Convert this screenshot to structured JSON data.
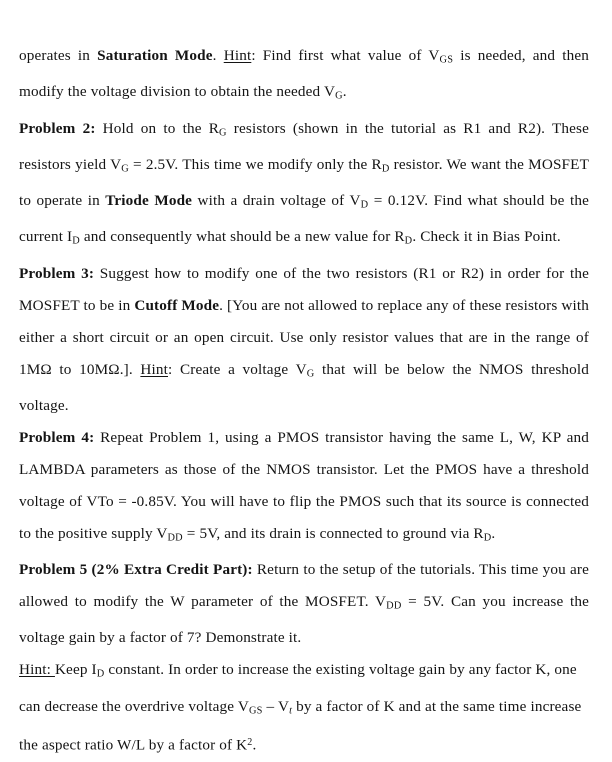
{
  "document": {
    "type": "homework-problem-set",
    "subject": "MOSFET bias and amplifier problems",
    "text_color": "#141414",
    "background_color": "#ffffff"
  },
  "paragraphs": [
    {
      "id": "problem1-tail",
      "heading": "",
      "runs": [
        {
          "text": "operates in ",
          "style": "normal"
        },
        {
          "text": "Saturation Mode",
          "style": "bold"
        },
        {
          "text": ". ",
          "style": "normal"
        },
        {
          "text": "Hint",
          "style": "underline"
        },
        {
          "text": ": Find first what value of V",
          "style": "normal"
        },
        {
          "text": "GS",
          "style": "subscript"
        },
        {
          "text": " is needed, and then modify the voltage division to obtain the needed V",
          "style": "normal"
        },
        {
          "text": "G",
          "style": "subscript"
        },
        {
          "text": ".",
          "style": "normal"
        }
      ],
      "plain": "operates in Saturation Mode. Hint: Find first what value of VGS is needed, and then modify the voltage division to obtain the needed VG."
    },
    {
      "id": "problem2",
      "heading": "Problem 2:",
      "runs": [
        {
          "text": "Problem 2:",
          "style": "bold"
        },
        {
          "text": " Hold on to the R",
          "style": "normal"
        },
        {
          "text": "G",
          "style": "subscript"
        },
        {
          "text": " resistors (shown in the tutorial as R1 and R2). These resistors yield V",
          "style": "normal"
        },
        {
          "text": "G",
          "style": "subscript"
        },
        {
          "text": " = 2.5V. This time we modify only the R",
          "style": "normal"
        },
        {
          "text": "D",
          "style": "subscript"
        },
        {
          "text": " resistor. We want the MOSFET to operate in ",
          "style": "normal"
        },
        {
          "text": "Triode Mode",
          "style": "bold"
        },
        {
          "text": " with a drain voltage of V",
          "style": "normal"
        },
        {
          "text": "D",
          "style": "subscript"
        },
        {
          "text": " = 0.12V. Find what should be the current I",
          "style": "normal"
        },
        {
          "text": "D",
          "style": "subscript"
        },
        {
          "text": " and consequently what should be a new value for R",
          "style": "normal"
        },
        {
          "text": "D",
          "style": "subscript"
        },
        {
          "text": ". Check it in Bias Point.",
          "style": "normal"
        }
      ],
      "plain": "Problem 2: Hold on to the RG resistors (shown in the tutorial as R1 and R2). These resistors yield VG = 2.5V. This time we modify only the RD resistor. We want the MOSFET to operate in Triode Mode with a drain voltage of VD = 0.12V. Find what should be the current ID and consequently what should be a new value for RD. Check it in Bias Point."
    },
    {
      "id": "problem3",
      "heading": "Problem 3:",
      "runs": [
        {
          "text": "Problem 3:",
          "style": "bold"
        },
        {
          "text": " Suggest how to modify one of the two resistors (R1 or R2) in order for the MOSFET to be in ",
          "style": "normal"
        },
        {
          "text": "Cutoff Mode",
          "style": "bold"
        },
        {
          "text": ". [You are not allowed to replace any of these resistors with either a short circuit or an open circuit. Use only resistor values that are in the range of 1MΩ to 10MΩ.]. ",
          "style": "normal"
        },
        {
          "text": "Hint",
          "style": "underline"
        },
        {
          "text": ": Create a voltage V",
          "style": "normal"
        },
        {
          "text": "G",
          "style": "subscript"
        },
        {
          "text": " that will be below the NMOS threshold voltage.",
          "style": "normal"
        }
      ],
      "plain": "Problem 3: Suggest how to modify one of the two resistors (R1 or R2) in order for the MOSFET to be in Cutoff Mode. [You are not allowed to replace any of these resistors with either a short circuit or an open circuit. Use only resistor values that are in the range of 1MΩ to 10MΩ.]. Hint: Create a voltage VG that will be below the NMOS threshold voltage."
    },
    {
      "id": "problem4",
      "heading": "Problem 4:",
      "runs": [
        {
          "text": "Problem 4:",
          "style": "bold"
        },
        {
          "text": " Repeat Problem 1, using a PMOS transistor having the same L, W, KP and LAMBDA parameters as those of the NMOS transistor. Let the PMOS have a threshold voltage of VTo = -0.85V. You will have to flip the PMOS such that its source is connected to the positive supply V",
          "style": "normal"
        },
        {
          "text": "DD",
          "style": "subscript"
        },
        {
          "text": " = 5V, and its drain is connected to ground via R",
          "style": "normal"
        },
        {
          "text": "D",
          "style": "subscript"
        },
        {
          "text": ".",
          "style": "normal"
        }
      ],
      "plain": "Problem 4: Repeat Problem 1, using a PMOS transistor having the same L, W, KP and LAMBDA parameters as those of the NMOS transistor. Let the PMOS have a threshold voltage of VTo = -0.85V. You will have to flip the PMOS such that its source is connected to the positive supply VDD = 5V, and its drain is connected to ground via RD."
    },
    {
      "id": "problem5",
      "heading": "Problem 5 (2% Extra Credit Part):",
      "runs": [
        {
          "text": "Problem 5 (2% Extra Credit Part):",
          "style": "bold"
        },
        {
          "text": " Return to the setup of the tutorials. This time you are allowed to modify the W parameter of the MOSFET. V",
          "style": "normal"
        },
        {
          "text": "DD",
          "style": "subscript"
        },
        {
          "text": " = 5V. Can you increase the voltage gain by a factor of 7? Demonstrate it.",
          "style": "normal"
        }
      ],
      "plain": "Problem 5 (2% Extra Credit Part): Return to the setup of the tutorials. This time you are allowed to modify the W parameter of the MOSFET. VDD = 5V. Can you increase the voltage gain by a factor of 7? Demonstrate it."
    },
    {
      "id": "problem5-hint",
      "heading": "Hint:",
      "runs": [
        {
          "text": "Hint: ",
          "style": "underline"
        },
        {
          "text": "Keep I",
          "style": "normal"
        },
        {
          "text": "D",
          "style": "subscript"
        },
        {
          "text": " constant. In order to increase the existing voltage gain by any factor K, one can decrease the overdrive voltage V",
          "style": "normal"
        },
        {
          "text": "GS",
          "style": "subscript"
        },
        {
          "text": " – V",
          "style": "normal"
        },
        {
          "text": "t",
          "style": "subscript"
        },
        {
          "text": " by a factor of K and at the same time increase the aspect ratio W/L by a factor of K",
          "style": "normal"
        },
        {
          "text": "2",
          "style": "superscript"
        },
        {
          "text": ".",
          "style": "normal"
        }
      ],
      "plain": "Hint: Keep ID constant. In order to increase the existing voltage gain by any factor K, one can decrease the overdrive voltage VGS – Vt by a factor of K and at the same time increase the aspect ratio W/L by a factor of K2."
    }
  ]
}
